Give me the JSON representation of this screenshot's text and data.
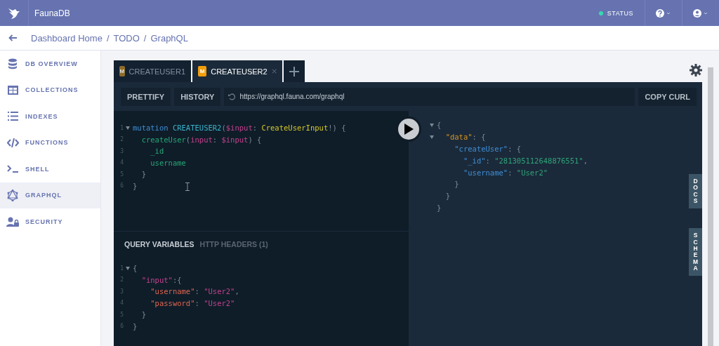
{
  "topbar": {
    "brand": "FaunaDB",
    "status": "STATUS"
  },
  "breadcrumb": [
    {
      "kind": "link",
      "text": "Dashboard Home"
    },
    {
      "kind": "separator",
      "text": "/"
    },
    {
      "kind": "link",
      "text": "TODO"
    },
    {
      "kind": "separator",
      "text": "/"
    },
    {
      "kind": "link",
      "text": "GraphQL"
    }
  ],
  "sidebar": {
    "items": [
      {
        "label": "DB OVERVIEW",
        "selected": false
      },
      {
        "label": "COLLECTIONS",
        "selected": false
      },
      {
        "label": "INDEXES",
        "selected": false
      },
      {
        "label": "FUNCTIONS",
        "selected": false
      },
      {
        "label": "SHELL",
        "selected": false
      },
      {
        "label": "GRAPHQL",
        "selected": true
      },
      {
        "label": "SECURITY",
        "selected": false
      }
    ]
  },
  "tabs": [
    {
      "badge": "M",
      "label": "CREATEUSER1",
      "selected": false
    },
    {
      "badge": "M",
      "label": "CREATEUSER2",
      "selected": true
    }
  ],
  "toolbar": {
    "buttons": [
      "PRETTIFY",
      "HISTORY"
    ],
    "url": "https://graphql.fauna.com/graphql",
    "copy": "COPY CURL"
  },
  "query": [
    {
      "number": "1",
      "fold": true,
      "tokens": [
        {
          "kind": "keyword",
          "text": "mutation "
        },
        {
          "kind": "name",
          "text": "CREATEUSER2"
        },
        {
          "kind": "punct",
          "text": "("
        },
        {
          "kind": "variable",
          "text": "$input"
        },
        {
          "kind": "punct",
          "text": ": "
        },
        {
          "kind": "type",
          "text": "CreateUserInput"
        },
        {
          "kind": "punct",
          "text": "!) {"
        }
      ]
    },
    {
      "number": "2",
      "fold": false,
      "tokens": [
        {
          "kind": "field",
          "text": "  createUser"
        },
        {
          "kind": "punct",
          "text": "("
        },
        {
          "kind": "variable",
          "text": "input"
        },
        {
          "kind": "punct",
          "text": ": "
        },
        {
          "kind": "variable",
          "text": "$input"
        },
        {
          "kind": "punct",
          "text": ") {"
        }
      ]
    },
    {
      "number": "3",
      "fold": false,
      "tokens": [
        {
          "kind": "field",
          "text": "    _id"
        }
      ]
    },
    {
      "number": "4",
      "fold": false,
      "tokens": [
        {
          "kind": "field",
          "text": "    username"
        }
      ]
    },
    {
      "number": "5",
      "fold": false,
      "tokens": [
        {
          "kind": "punct",
          "text": "  }"
        }
      ]
    },
    {
      "number": "6",
      "fold": false,
      "tokens": [
        {
          "kind": "punct",
          "text": "}"
        }
      ]
    }
  ],
  "result": [
    {
      "fold": true,
      "tokens": [
        {
          "kind": "punct",
          "text": "{"
        }
      ]
    },
    {
      "fold": true,
      "tokens": [
        {
          "kind": "datakey",
          "text": "  \"data\""
        },
        {
          "kind": "punct",
          "text": ": {"
        }
      ]
    },
    {
      "fold": false,
      "tokens": [
        {
          "kind": "key",
          "text": "    \"createUser\""
        },
        {
          "kind": "punct",
          "text": ": {"
        }
      ]
    },
    {
      "fold": false,
      "tokens": [
        {
          "kind": "key",
          "text": "      \"_id\""
        },
        {
          "kind": "punct",
          "text": ": "
        },
        {
          "kind": "string",
          "text": "\"281305112648876551\""
        },
        {
          "kind": "punct",
          "text": ","
        }
      ]
    },
    {
      "fold": false,
      "tokens": [
        {
          "kind": "key",
          "text": "      \"username\""
        },
        {
          "kind": "punct",
          "text": ": "
        },
        {
          "kind": "string",
          "text": "\"User2\""
        }
      ]
    },
    {
      "fold": false,
      "tokens": [
        {
          "kind": "punct",
          "text": "    }"
        }
      ]
    },
    {
      "fold": false,
      "tokens": [
        {
          "kind": "punct",
          "text": "  }"
        }
      ]
    },
    {
      "fold": false,
      "tokens": [
        {
          "kind": "punct",
          "text": "}"
        }
      ]
    }
  ],
  "side_tabs": [
    "DOCS",
    "SCHEMA"
  ],
  "variables_tabs": [
    {
      "label": "QUERY VARIABLES",
      "selected": true
    },
    {
      "label": "HTTP HEADERS (1)",
      "selected": false
    }
  ],
  "variables": [
    {
      "number": "1",
      "fold": true,
      "tokens": [
        {
          "kind": "punct",
          "text": "{"
        }
      ]
    },
    {
      "number": "2",
      "fold": false,
      "tokens": [
        {
          "kind": "variable",
          "text": "  \"input\""
        },
        {
          "kind": "punct",
          "text": ":{"
        }
      ]
    },
    {
      "number": "3",
      "fold": false,
      "tokens": [
        {
          "kind": "varkey",
          "text": "    \"username\""
        },
        {
          "kind": "punct",
          "text": ": "
        },
        {
          "kind": "variable",
          "text": "\"User2\""
        },
        {
          "kind": "punct",
          "text": ","
        }
      ]
    },
    {
      "number": "4",
      "fold": false,
      "tokens": [
        {
          "kind": "varkey",
          "text": "    \"password\""
        },
        {
          "kind": "punct",
          "text": ": "
        },
        {
          "kind": "variable",
          "text": "\"User2\""
        }
      ]
    },
    {
      "number": "5",
      "fold": false,
      "tokens": [
        {
          "kind": "punct",
          "text": "  }"
        }
      ]
    },
    {
      "number": "6",
      "fold": false,
      "tokens": [
        {
          "kind": "punct",
          "text": "}"
        }
      ]
    }
  ]
}
